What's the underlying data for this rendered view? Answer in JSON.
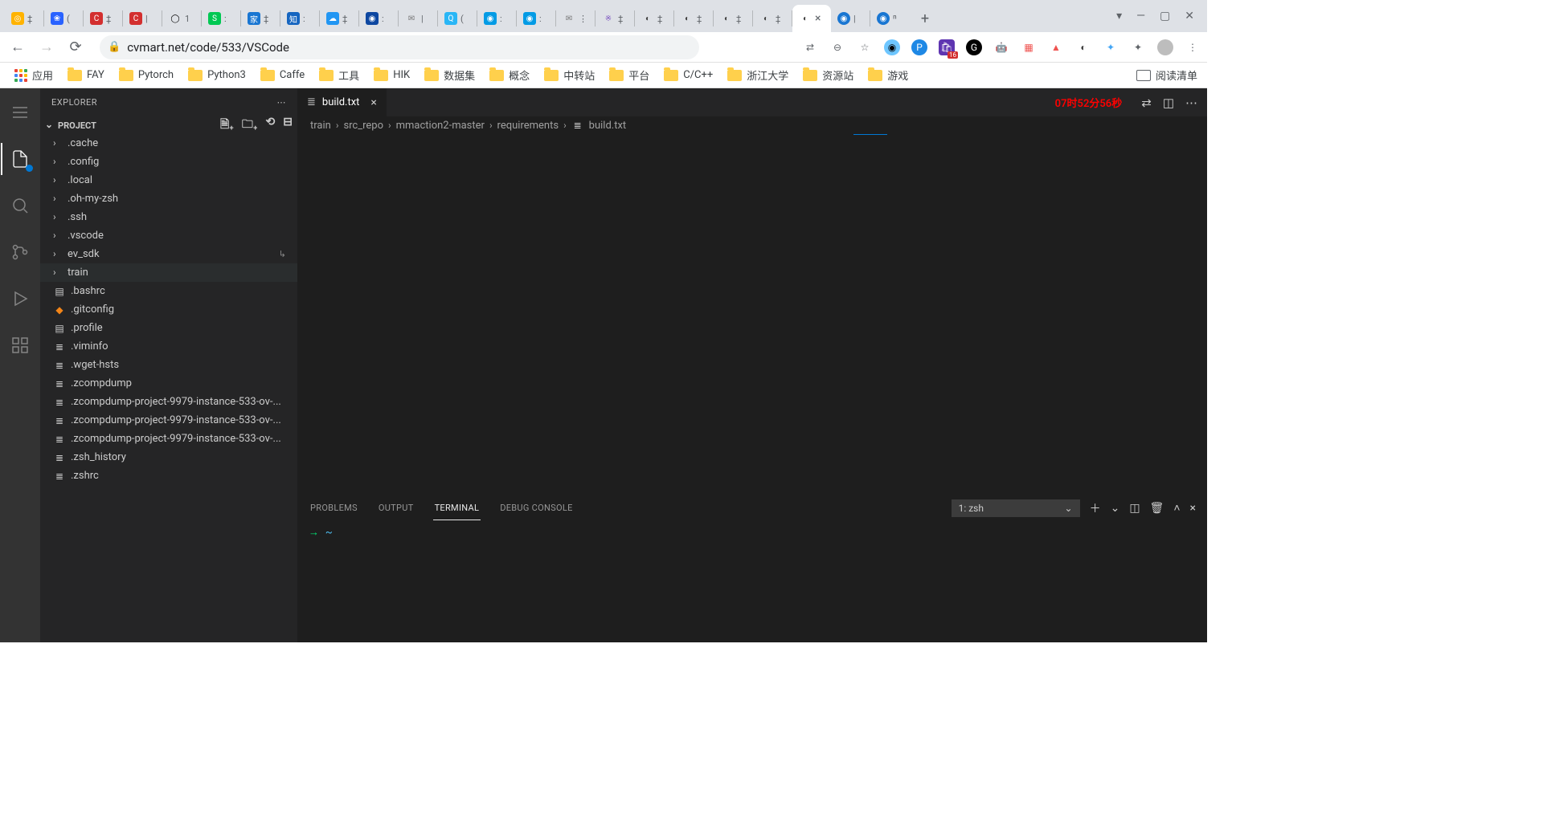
{
  "browser": {
    "url": "cvmart.net/code/533/VSCode",
    "tabs_active_index": 20,
    "new_tab_glyph": "+",
    "window_controls": {
      "down": "▾",
      "min": "—",
      "max": "▢",
      "close": "✕"
    },
    "nav": {
      "back": "←",
      "forward": "→",
      "reload": "⟳"
    },
    "addr_icons": {
      "translate": "⇄",
      "zoom": "🔍",
      "star": "☆"
    },
    "ext_badge": "16",
    "bookmarks": {
      "apps_label": "应用",
      "items": [
        "FAY",
        "Pytorch",
        "Python3",
        "Caffe",
        "工具",
        "HIK",
        "数据集",
        "概念",
        "中转站",
        "平台",
        "C/C++",
        "浙江大学",
        "资源站",
        "游戏"
      ],
      "reading_list": "阅读清单"
    }
  },
  "vscode": {
    "explorer_title": "EXPLORER",
    "project_label": "PROJECT",
    "timer": "07时52分56秒",
    "tree": {
      "folders": [
        ".cache",
        ".config",
        ".local",
        ".oh-my-zsh",
        ".ssh",
        ".vscode",
        "ev_sdk",
        "train"
      ],
      "files": [
        ".bashrc",
        ".gitconfig",
        ".profile",
        ".viminfo",
        ".wget-hsts",
        ".zcompdump",
        ".zcompdump-project-9979-instance-533-ov-...",
        ".zcompdump-project-9979-instance-533-ov-...",
        ".zcompdump-project-9979-instance-533-ov-...",
        ".zsh_history",
        ".zshrc"
      ]
    },
    "open_tab": {
      "label": "build.txt"
    },
    "breadcrumb": [
      "train",
      "src_repo",
      "mmaction2-master",
      "requirements",
      "build.txt"
    ],
    "panel": {
      "tabs": [
        "PROBLEMS",
        "OUTPUT",
        "TERMINAL",
        "DEBUG CONSOLE"
      ],
      "active_index": 2,
      "terminal_selector": "1: zsh",
      "prompt": {
        "arrow": "→",
        "tilde": "~"
      }
    }
  }
}
